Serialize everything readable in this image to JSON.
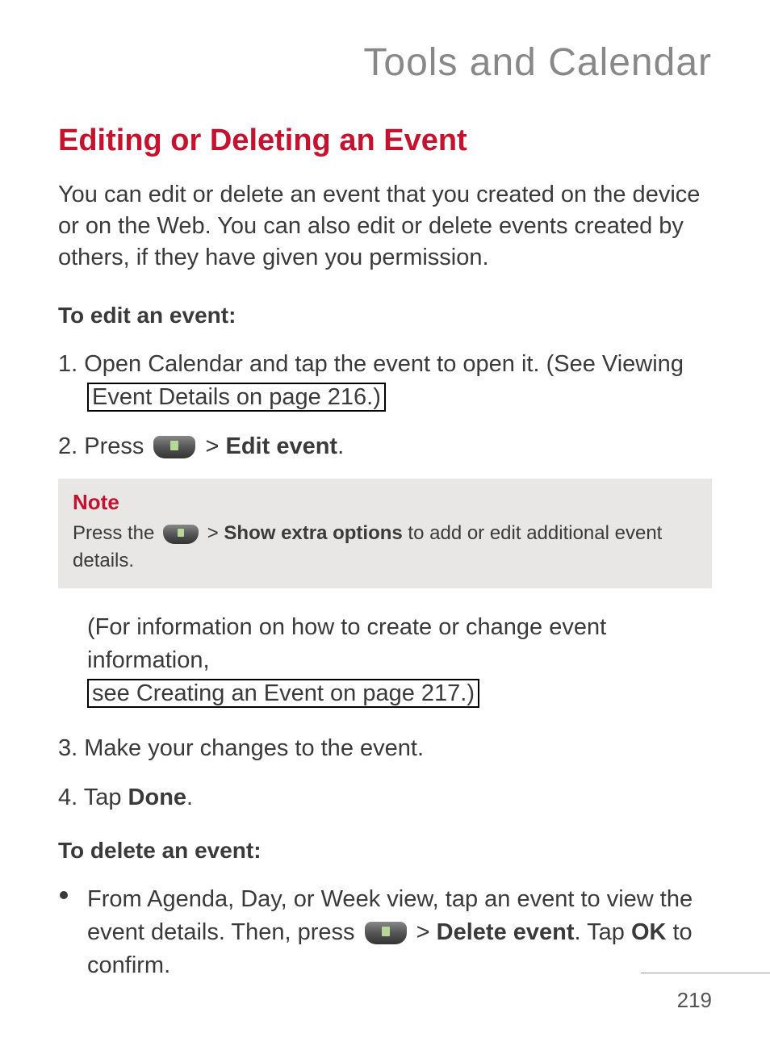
{
  "pageTitle": "Tools and Calendar",
  "sectionHeading": "Editing or Deleting an Event",
  "introText": "You can edit or delete an event that you created on the device or on the Web. You can also edit or delete events created by others, if they have given you permission.",
  "editHeading": "To edit an event:",
  "step1_pre": "1. Open Calendar and tap the event to open it. (See Viewing ",
  "step1_link": "Event Details on page 216.)",
  "step2_pre": "2. Press ",
  "step2_gt": " > ",
  "step2_bold": "Edit event",
  "step2_post": ".",
  "noteTitle": "Note",
  "note_pre": "Press the ",
  "note_gt": " > ",
  "note_bold": "Show extra options",
  "note_post": " to add or edit additional event details.",
  "paren_pre": "(For information on how to create or change event information, ",
  "paren_link": "see Creating an Event on page 217.)",
  "step3": "3. Make your changes to the event.",
  "step4_pre": "4. Tap ",
  "step4_bold": "Done",
  "step4_post": ".",
  "deleteHeading": "To delete an event:",
  "bullet_pre": "From Agenda, Day, or Week view, tap an event to view the event details. Then, press ",
  "bullet_gt": " > ",
  "bullet_bold1": "Delete event",
  "bullet_mid": ". Tap ",
  "bullet_bold2": "OK",
  "bullet_post": " to confirm.",
  "pageNumber": "219"
}
